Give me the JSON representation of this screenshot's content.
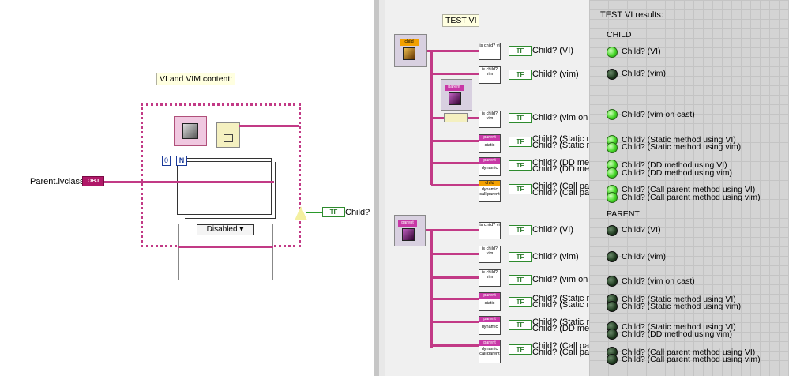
{
  "left": {
    "vi_label": "VI and VIM content:",
    "input_label": "Parent.lvclass",
    "obj_tag": "OBJ",
    "n_terminal": "N",
    "zero_const": "0",
    "disabled_select": "Disabled",
    "output_label": "Child?"
  },
  "middle": {
    "title": "TEST VI",
    "child_class_tag": "child",
    "parent_class_tag": "parent",
    "block_is_child_vi": "is child? vi",
    "block_is_child_vim": "is child? vim",
    "tag_parent": "parent",
    "tag_child": "child",
    "text_static": "static",
    "text_dynamic": "dynamic",
    "text_dynamic_call_parent": "dynamic call parent",
    "tf": "TF",
    "labels_top": [
      "Child? (VI)",
      "Child? (vim)",
      "Child? (vim on c",
      "Child? (Static m",
      "Child? (Static m",
      "Child? (DD meth",
      "Child? (DD meth",
      "Child? (Call pare",
      "Child? (Call pare"
    ],
    "labels_bottom": [
      "Child? (VI)",
      "Child? (vim)",
      "Child? (vim on c",
      "Child? (Static m",
      "Child? (Static m",
      "Child? (Static m",
      "Child? (DD meth",
      "Child? (Call pare",
      "Child? (Call pare"
    ]
  },
  "right": {
    "title": "TEST VI results:",
    "child_header": "CHILD",
    "parent_header": "PARENT",
    "child_items": [
      {
        "label": "Child? (VI)",
        "on": true
      },
      {
        "label": "Child? (vim)",
        "on": false
      },
      {
        "label": "Child? (vim on cast)",
        "on": true
      },
      {
        "label": "Child? (Static method using VI)",
        "on": true
      },
      {
        "label": "Child? (Static method using vim)",
        "on": true
      },
      {
        "label": "Child? (DD method using VI)",
        "on": true
      },
      {
        "label": "Child? (DD method using vim)",
        "on": true
      },
      {
        "label": "Child? (Call parent method using VI)",
        "on": true
      },
      {
        "label": "Child? (Call parent method using vim)",
        "on": true
      }
    ],
    "parent_items": [
      {
        "label": "Child? (VI)",
        "on": false
      },
      {
        "label": "Child? (vim)",
        "on": false
      },
      {
        "label": "Child? (vim on cast)",
        "on": false
      },
      {
        "label": "Child? (Static method using VI)",
        "on": false
      },
      {
        "label": "Child? (Static method using vim)",
        "on": false
      },
      {
        "label": "Child? (Static method using VI)",
        "on": false
      },
      {
        "label": "Child? (DD method using vim)",
        "on": false
      },
      {
        "label": "Child? (Call parent method using VI)",
        "on": false
      },
      {
        "label": "Child? (Call parent method using vim)",
        "on": false
      }
    ]
  }
}
